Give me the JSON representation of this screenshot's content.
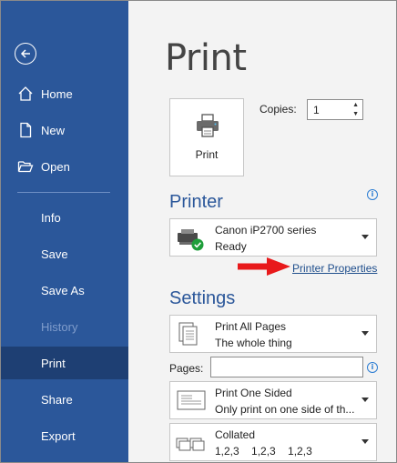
{
  "sidebar": {
    "back_icon": "back-arrow-icon",
    "items": [
      {
        "label": "Home",
        "icon": "home-icon"
      },
      {
        "label": "New",
        "icon": "new-document-icon"
      },
      {
        "label": "Open",
        "icon": "open-folder-icon"
      },
      {
        "label": "Info"
      },
      {
        "label": "Save"
      },
      {
        "label": "Save As"
      },
      {
        "label": "History",
        "disabled": true
      },
      {
        "label": "Print",
        "active": true
      },
      {
        "label": "Share"
      },
      {
        "label": "Export"
      }
    ]
  },
  "main": {
    "title": "Print",
    "print_button_label": "Print",
    "copies_label": "Copies:",
    "copies_value": "1",
    "printer_heading": "Printer",
    "printer": {
      "name": "Canon iP2700 series",
      "status": "Ready"
    },
    "printer_properties_link": "Printer Properties",
    "settings_heading": "Settings",
    "settings": [
      {
        "line1": "Print All Pages",
        "line2": "The whole thing"
      },
      {
        "line1": "Print One Sided",
        "line2": "Only print on one side of th..."
      },
      {
        "line1": "Collated",
        "line2": "1,2,3    1,2,3    1,2,3"
      }
    ],
    "pages_label": "Pages:",
    "pages_value": ""
  },
  "colors": {
    "sidebar_bg": "#2b579a",
    "sidebar_active": "#1e3f73",
    "accent_text": "#2b579a",
    "annotation_arrow": "#e8191b",
    "ready_check": "#1e9e3a"
  }
}
